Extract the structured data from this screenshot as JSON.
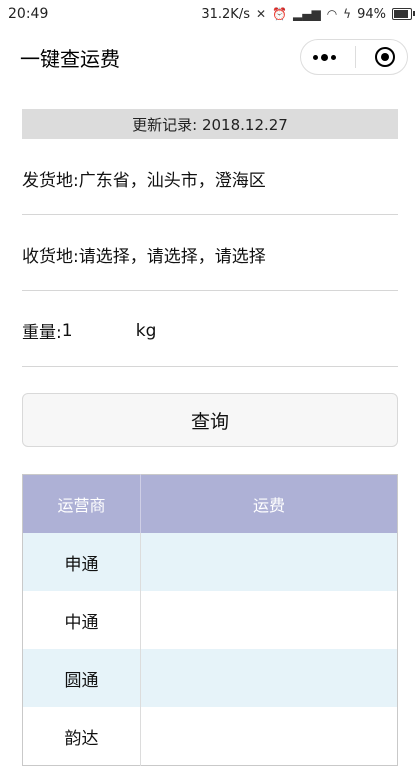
{
  "status_bar": {
    "time": "20:49",
    "network_speed": "31.2K/s",
    "battery_percent": "94%",
    "battery_level": 0.94
  },
  "nav": {
    "title": "一键查运费"
  },
  "update": {
    "text": "更新记录: 2018.12.27"
  },
  "form": {
    "origin_label": "发货地:",
    "origin_value": "广东省，汕头市，澄海区",
    "destination_label": "收货地:",
    "destination_value": "请选择，请选择，请选择",
    "weight_label": "重量:",
    "weight_value": "1",
    "weight_unit": "kg"
  },
  "query_button": {
    "label": "查询"
  },
  "table": {
    "headers": [
      "运营商",
      "运费"
    ],
    "rows": [
      {
        "carrier": "申通",
        "fee": ""
      },
      {
        "carrier": "中通",
        "fee": ""
      },
      {
        "carrier": "圆通",
        "fee": ""
      },
      {
        "carrier": "韵达",
        "fee": ""
      }
    ]
  },
  "colors": {
    "header_bg": "#aeb1d6",
    "odd_row_bg": "#e6f3f9",
    "banner_bg": "#dcdcdc"
  }
}
